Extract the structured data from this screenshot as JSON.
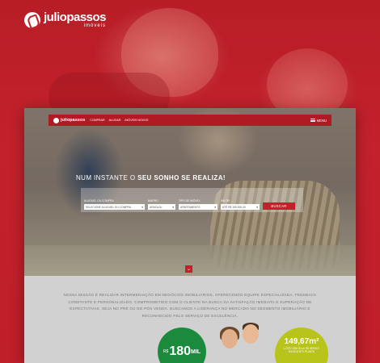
{
  "brand": {
    "name": "juliopassos",
    "sub": "imóveis"
  },
  "site": {
    "logo": "juliopassos",
    "nav": [
      "COMPRAR",
      "ALUGAR",
      "IMÓVEIS NOVOS"
    ],
    "menu_label": "MENU",
    "headline_start": "NUM INSTANTE O ",
    "headline_bold": "SEU SONHO SE REALIZA!",
    "search": {
      "fields": [
        {
          "label": "ALUGUEL OU COMPRA",
          "value": "SELECIONE ALUGUEL OU COMPRA"
        },
        {
          "label": "BAIRRO",
          "value": "ARACAJU"
        },
        {
          "label": "TIPO DE IMÓVEL",
          "value": "APARTAMENTO"
        },
        {
          "label": "VALOR",
          "value": "ATÉ R$ 150.000,00"
        }
      ],
      "button": "BUSCAR"
    },
    "mission": "NOSSA MISSÃO É REALIZAR INTERMEDIAÇÃO EM NEGÓCIOS IMOBILIÁRIOS, OFERECENDO EQUIPE ESPECIALIZADA, FEEDBACK CONSTANTE E PERSONALIZADO, COMPROMETIDO COM O CLIENTE NA BUSCA DA SATISFAÇÃO IMEDIATA E SUPERAÇÃO DE EXPECTATIVAS, SEJA NO PRÉ OU NO PÓS VENDA. BUSCAMOS A LIDERANÇA NO MERCADO NO SEGMENTO IMOBILIÁRIO E RECONHECIDO PELO SERVIÇO DE EXCELÊNCIA.",
    "promo_price": {
      "currency": "R$",
      "number": "180",
      "unit": "MIL"
    },
    "promo_area": {
      "value": "149,67m²",
      "sub": "LOTE COM 30 m² DE ÁREA E EXCELENTE PLANTA"
    }
  },
  "colors": {
    "brand_red": "#c5202a",
    "green": "#1b8a3c",
    "lime": "#b9c41a"
  }
}
